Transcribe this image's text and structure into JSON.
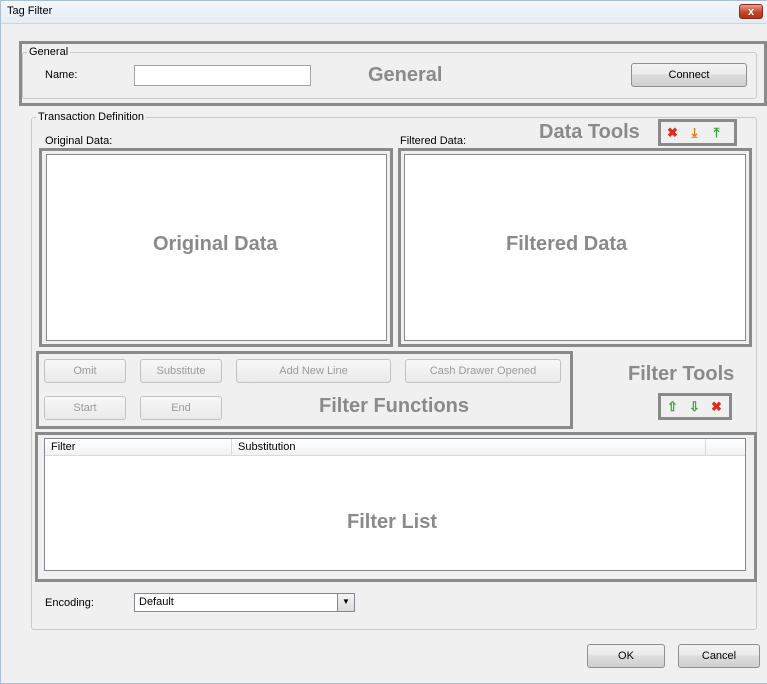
{
  "window": {
    "title": "Tag Filter",
    "close_glyph": "x"
  },
  "general": {
    "legend": "General",
    "name_label": "Name:",
    "name_value": "",
    "annotation": "General",
    "connect_label": "Connect"
  },
  "transaction": {
    "legend": "Transaction Definition",
    "original_label": "Original Data:",
    "filtered_label": "Filtered Data:",
    "original_annotation": "Original Data",
    "filtered_annotation": "Filtered Data",
    "data_tools_annotation": "Data Tools",
    "data_tools": [
      {
        "icon": "delete-icon",
        "glyph": "✖",
        "color": "#e02a1c"
      },
      {
        "icon": "import-icon",
        "glyph": "⤓",
        "color": "#e07a1a"
      },
      {
        "icon": "export-icon",
        "glyph": "⤒",
        "color": "#35a52a"
      }
    ]
  },
  "filter_functions": {
    "annotation": "Filter Functions",
    "buttons": [
      "Omit",
      "Substitute",
      "Add New Line",
      "Cash Drawer Opened",
      "Start",
      "End"
    ]
  },
  "filter_tools": {
    "annotation": "Filter Tools",
    "tools": [
      {
        "icon": "move-up-icon",
        "glyph": "⇧",
        "color": "#35a52a"
      },
      {
        "icon": "move-down-icon",
        "glyph": "⇩",
        "color": "#35a52a"
      },
      {
        "icon": "remove-icon",
        "glyph": "✖",
        "color": "#e02a1c"
      }
    ]
  },
  "filter_list": {
    "annotation": "Filter List",
    "columns": [
      "Filter",
      "Substitution"
    ],
    "rows": []
  },
  "encoding": {
    "label": "Encoding:",
    "value": "Default"
  },
  "footer": {
    "ok_label": "OK",
    "cancel_label": "Cancel"
  }
}
